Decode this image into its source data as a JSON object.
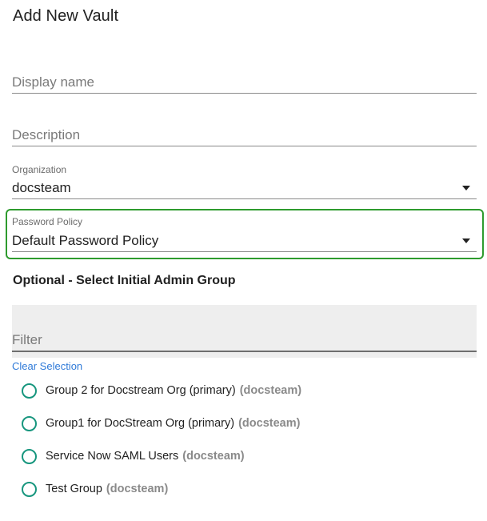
{
  "page": {
    "title": "Add New Vault"
  },
  "form": {
    "display_name": {
      "placeholder": "Display name",
      "value": ""
    },
    "description": {
      "placeholder": "Description",
      "value": ""
    },
    "organization": {
      "label": "Organization",
      "value": "docsteam"
    },
    "password_policy": {
      "label": "Password Policy",
      "value": "Default Password Policy"
    }
  },
  "admin_group": {
    "section_title": "Optional - Select Initial Admin Group",
    "filter_placeholder": "Filter",
    "clear_selection_label": "Clear Selection",
    "groups": [
      {
        "name": "Group 2 for Docstream Org (primary)",
        "org": "(docsteam)"
      },
      {
        "name": "Group1 for DocStream Org (primary)",
        "org": "(docsteam)"
      },
      {
        "name": "Service Now SAML Users",
        "org": "(docsteam)"
      },
      {
        "name": "Test Group",
        "org": "(docsteam)"
      }
    ]
  },
  "colors": {
    "highlight": "#2e9b2e",
    "radio": "#17967e",
    "link": "#2f7ad8"
  },
  "icons": {
    "dropdown": "dropdown-arrow-icon",
    "radio": "radio-unchecked-icon"
  }
}
